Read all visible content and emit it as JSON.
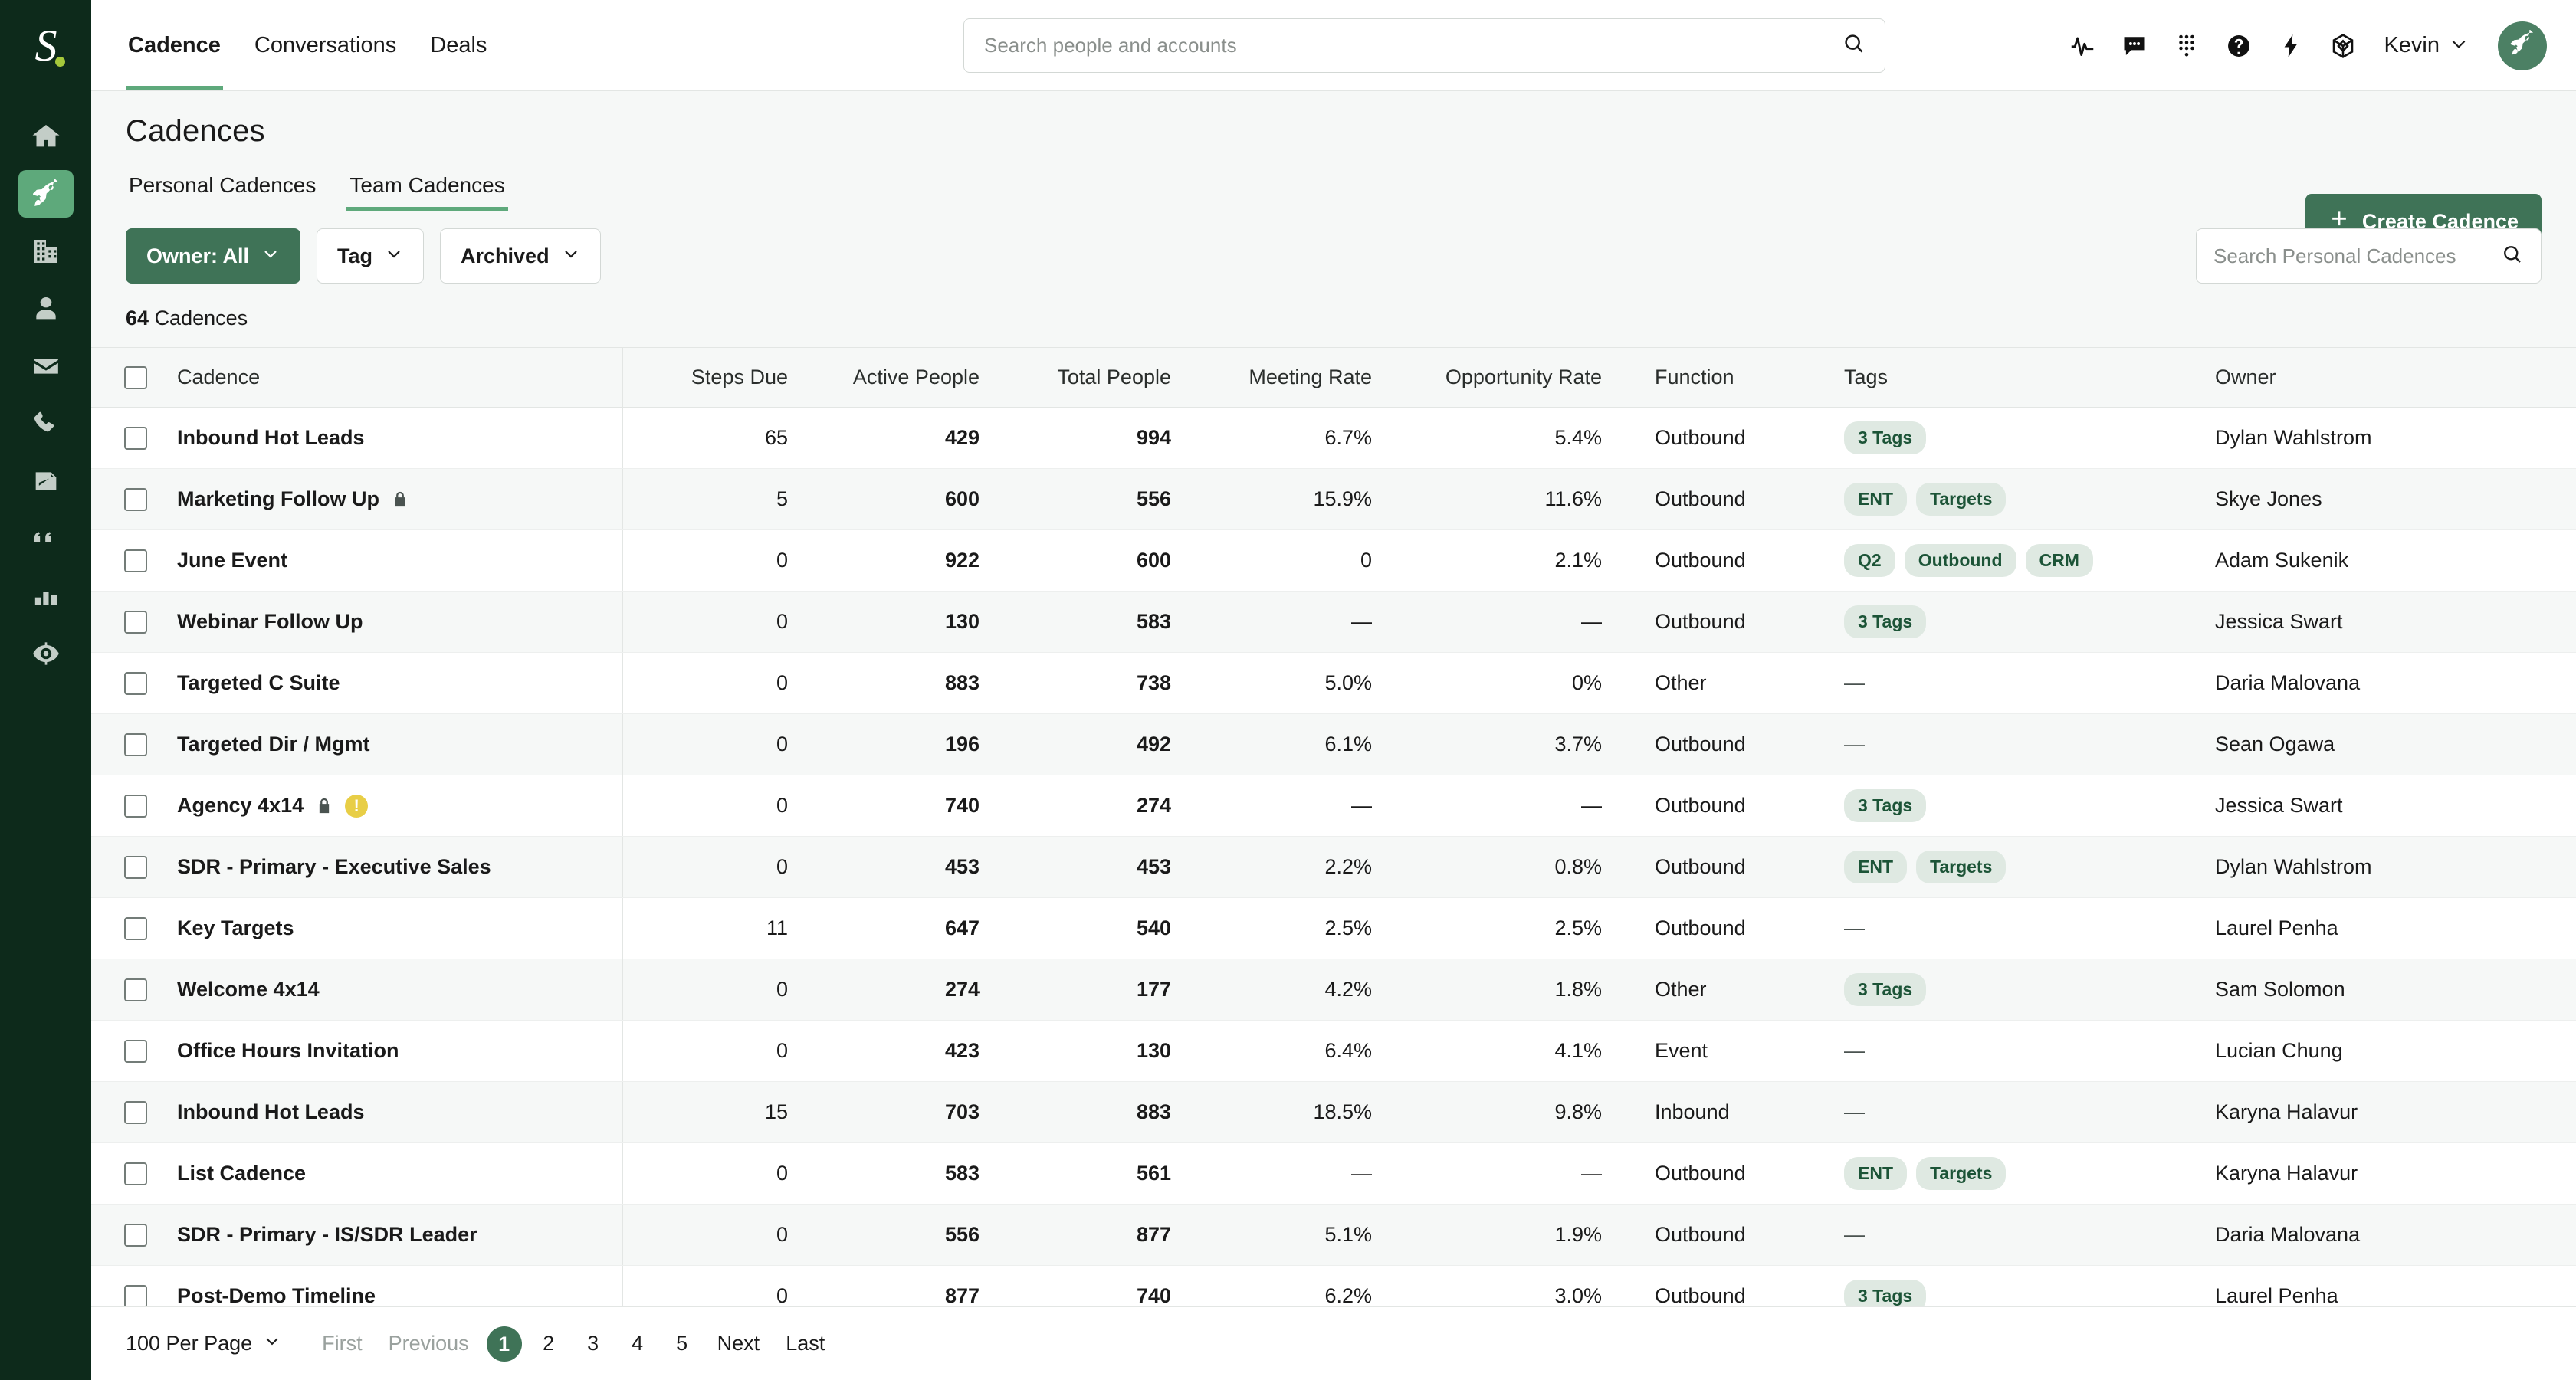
{
  "brand": {
    "logo_letter": "S",
    "accent_dot_color": "#A5C83B",
    "sidebar_bg": "#0D2A1B",
    "primary_green": "#3F7357",
    "accent_green": "#5EA97B"
  },
  "sidebar": {
    "items": [
      {
        "icon": "home-icon",
        "name": "home",
        "active": false
      },
      {
        "icon": "rocket-icon",
        "name": "cadence",
        "active": true
      },
      {
        "icon": "building-icon",
        "name": "accounts",
        "active": false
      },
      {
        "icon": "person-icon",
        "name": "people",
        "active": false
      },
      {
        "icon": "envelope-icon",
        "name": "emails",
        "active": false
      },
      {
        "icon": "phone-icon",
        "name": "calls",
        "active": false
      },
      {
        "icon": "document-icon",
        "name": "templates",
        "active": false
      },
      {
        "icon": "quote-icon",
        "name": "snippets",
        "active": false
      },
      {
        "icon": "bar-chart-icon",
        "name": "analytics",
        "active": false
      },
      {
        "icon": "target-icon",
        "name": "goals",
        "active": false
      }
    ]
  },
  "topbar": {
    "nav": [
      {
        "label": "Cadence",
        "active": true
      },
      {
        "label": "Conversations",
        "active": false
      },
      {
        "label": "Deals",
        "active": false
      }
    ],
    "search": {
      "placeholder": "Search people and accounts",
      "value": "",
      "icon": "search-icon"
    },
    "icons": [
      {
        "name": "activity-pulse-icon"
      },
      {
        "name": "chat-bubble-icon"
      },
      {
        "name": "dialpad-icon"
      },
      {
        "name": "help-circle-icon"
      },
      {
        "name": "lightning-bolt-icon"
      },
      {
        "name": "hexagon-gem-icon"
      }
    ],
    "user_name": "Kevin",
    "avatar_icon": "rocket-icon"
  },
  "page": {
    "title": "Cadences",
    "create_button": {
      "label": "Create Cadence",
      "icon": "plus-icon"
    },
    "tabs": [
      {
        "label": "Personal Cadences",
        "active": false
      },
      {
        "label": "Team Cadences",
        "active": true
      }
    ],
    "filters": [
      {
        "label": "Owner: All",
        "primary": true
      },
      {
        "label": "Tag",
        "primary": false
      },
      {
        "label": "Archived",
        "primary": false
      }
    ],
    "cadence_search": {
      "placeholder": "Search Personal Cadences",
      "value": "",
      "icon": "search-icon"
    },
    "count_number": "64",
    "count_label": "Cadences"
  },
  "table": {
    "columns": [
      "Cadence",
      "Steps Due",
      "Active People",
      "Total People",
      "Meeting Rate",
      "Opportunity Rate",
      "Function",
      "Tags",
      "Owner"
    ],
    "rows": [
      {
        "name": "Inbound Hot Leads",
        "lock": false,
        "warn": false,
        "steps": "65",
        "active": "429",
        "total": "994",
        "meeting": "6.7%",
        "opportunity": "5.4%",
        "function": "Outbound",
        "tags": [
          "3 Tags"
        ],
        "owner": "Dylan Wahlstrom"
      },
      {
        "name": "Marketing Follow Up",
        "lock": true,
        "warn": false,
        "steps": "5",
        "active": "600",
        "total": "556",
        "meeting": "15.9%",
        "opportunity": "11.6%",
        "function": "Outbound",
        "tags": [
          "ENT",
          "Targets"
        ],
        "owner": "Skye Jones"
      },
      {
        "name": "June Event",
        "lock": false,
        "warn": false,
        "steps": "0",
        "active": "922",
        "total": "600",
        "meeting": "0",
        "opportunity": "2.1%",
        "function": "Outbound",
        "tags": [
          "Q2",
          "Outbound",
          "CRM"
        ],
        "owner": "Adam Sukenik"
      },
      {
        "name": "Webinar Follow Up",
        "lock": false,
        "warn": false,
        "steps": "0",
        "active": "130",
        "total": "583",
        "meeting": "—",
        "opportunity": "—",
        "function": "Outbound",
        "tags": [
          "3 Tags"
        ],
        "owner": "Jessica Swart"
      },
      {
        "name": "Targeted C Suite",
        "lock": false,
        "warn": false,
        "steps": "0",
        "active": "883",
        "total": "738",
        "meeting": "5.0%",
        "opportunity": "0%",
        "function": "Other",
        "tags": [],
        "owner": "Daria Malovana"
      },
      {
        "name": "Targeted Dir / Mgmt",
        "lock": false,
        "warn": false,
        "steps": "0",
        "active": "196",
        "total": "492",
        "meeting": "6.1%",
        "opportunity": "3.7%",
        "function": "Outbound",
        "tags": [],
        "owner": "Sean Ogawa"
      },
      {
        "name": "Agency 4x14",
        "lock": true,
        "warn": true,
        "steps": "0",
        "active": "740",
        "total": "274",
        "meeting": "—",
        "opportunity": "—",
        "function": "Outbound",
        "tags": [
          "3 Tags"
        ],
        "owner": "Jessica Swart"
      },
      {
        "name": "SDR - Primary - Executive Sales",
        "lock": false,
        "warn": false,
        "steps": "0",
        "active": "453",
        "total": "453",
        "meeting": "2.2%",
        "opportunity": "0.8%",
        "function": "Outbound",
        "tags": [
          "ENT",
          "Targets"
        ],
        "owner": "Dylan Wahlstrom"
      },
      {
        "name": "Key Targets",
        "lock": false,
        "warn": false,
        "steps": "11",
        "active": "647",
        "total": "540",
        "meeting": "2.5%",
        "opportunity": "2.5%",
        "function": "Outbound",
        "tags": [],
        "owner": "Laurel Penha"
      },
      {
        "name": "Welcome 4x14",
        "lock": false,
        "warn": false,
        "steps": "0",
        "active": "274",
        "total": "177",
        "meeting": "4.2%",
        "opportunity": "1.8%",
        "function": "Other",
        "tags": [
          "3 Tags"
        ],
        "owner": "Sam Solomon"
      },
      {
        "name": "Office Hours Invitation",
        "lock": false,
        "warn": false,
        "steps": "0",
        "active": "423",
        "total": "130",
        "meeting": "6.4%",
        "opportunity": "4.1%",
        "function": "Event",
        "tags": [],
        "owner": "Lucian Chung"
      },
      {
        "name": "Inbound Hot Leads",
        "lock": false,
        "warn": false,
        "steps": "15",
        "active": "703",
        "total": "883",
        "meeting": "18.5%",
        "opportunity": "9.8%",
        "function": "Inbound",
        "tags": [],
        "owner": "Karyna Halavur"
      },
      {
        "name": "List Cadence",
        "lock": false,
        "warn": false,
        "steps": "0",
        "active": "583",
        "total": "561",
        "meeting": "—",
        "opportunity": "—",
        "function": "Outbound",
        "tags": [
          "ENT",
          "Targets"
        ],
        "owner": "Karyna Halavur"
      },
      {
        "name": "SDR - Primary - IS/SDR Leader",
        "lock": false,
        "warn": false,
        "steps": "0",
        "active": "556",
        "total": "877",
        "meeting": "5.1%",
        "opportunity": "1.9%",
        "function": "Outbound",
        "tags": [],
        "owner": "Daria Malovana"
      },
      {
        "name": "Post-Demo Timeline",
        "lock": false,
        "warn": false,
        "steps": "0",
        "active": "877",
        "total": "740",
        "meeting": "6.2%",
        "opportunity": "3.0%",
        "function": "Outbound",
        "tags": [
          "3 Tags"
        ],
        "owner": "Laurel Penha"
      }
    ]
  },
  "pagination": {
    "per_page_label": "100 Per Page",
    "first_label": "First",
    "previous_label": "Previous",
    "pages": [
      "1",
      "2",
      "3",
      "4",
      "5"
    ],
    "current_page": "1",
    "next_label": "Next",
    "last_label": "Last"
  }
}
